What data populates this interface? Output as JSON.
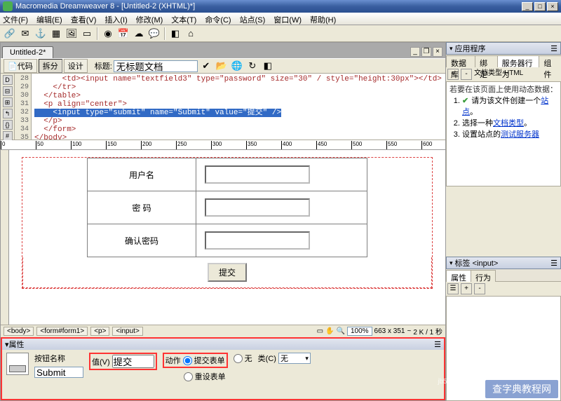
{
  "app": {
    "title": "Macromedia Dreamweaver 8 - [Untitled-2 (XHTML)*]"
  },
  "menu": {
    "items": [
      "文件(F)",
      "编辑(E)",
      "查看(V)",
      "插入(I)",
      "修改(M)",
      "文本(T)",
      "命令(C)",
      "站点(S)",
      "窗口(W)",
      "帮助(H)"
    ]
  },
  "doc": {
    "tab": "Untitled-2*",
    "views": {
      "code": "代码",
      "split": "拆分",
      "design": "设计"
    },
    "title_label": "标题:",
    "title_value": "无标题文档"
  },
  "code": {
    "startLine": 28,
    "lines": [
      "      <td><input name=\"textfield3\" type=\"password\" size=\"30\" / style=\"height:30px\"></td>",
      "    </tr>",
      "  </table>",
      "  <p align=\"center\">",
      "    <input type=\"submit\" name=\"Submit\" value=\"提交\" />",
      "  </p>",
      "  </form>",
      "</body>"
    ],
    "selectedLineIndex": 4
  },
  "ruler": [
    0,
    50,
    100,
    150,
    200,
    250,
    300,
    350,
    400,
    450,
    500,
    550,
    600
  ],
  "form": {
    "rows": [
      {
        "label": "用户名",
        "type": "text"
      },
      {
        "label": "密  码",
        "type": "password"
      },
      {
        "label": "确认密码",
        "type": "password"
      }
    ],
    "submit": "提交"
  },
  "status": {
    "crumbs": [
      "<body>",
      "<form#form1>",
      "<p>",
      "<input>"
    ],
    "zoom": "100%",
    "dims": "663 x 351",
    "rate": "2 K / 1 秒"
  },
  "props": {
    "panel": "属性",
    "name_label": "按钮名称",
    "name_value": "Submit",
    "value_label": "值(V)",
    "value_value": "提交",
    "action_label": "动作",
    "action_opt1": "提交表单",
    "action_opt2": "重设表单",
    "action_opt3": "无",
    "class_label": "类(C)",
    "class_value": "无"
  },
  "panels": {
    "app": {
      "title": "应用程序",
      "tabs": [
        "数据库",
        "绑定",
        "服务器行为",
        "组件"
      ],
      "active": 2
    },
    "app_toolbar": {
      "doctype_label": "文档类型",
      "doctype": "HTML"
    },
    "hints": {
      "lead": "若要在该页面上使用动态数据：",
      "items": [
        "请为该文件创建一个",
        "选择一种",
        "设置站点的"
      ],
      "links": [
        "站点",
        "文档类型",
        "测试服务器"
      ],
      "dot": "。"
    },
    "tag": {
      "title": "标签 <input>",
      "tabs": [
        "属性",
        "行为"
      ],
      "active": 0
    }
  },
  "watermark": "查字典教程网",
  "watermark2": "jb51.net  www.jiaocheng.chazidian.com"
}
